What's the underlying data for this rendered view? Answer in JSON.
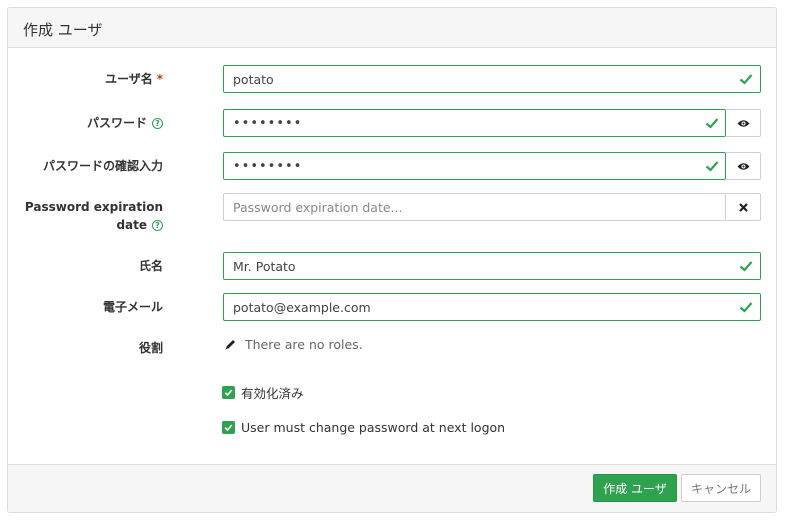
{
  "header": {
    "title": "作成 ユーザ"
  },
  "fields": {
    "username": {
      "label": "ユーザ名",
      "required_mark": "*",
      "value": "potato"
    },
    "password": {
      "label": "パスワード",
      "value": "••••••••"
    },
    "password_confirm": {
      "label": "パスワードの確認入力",
      "value": "••••••••"
    },
    "expiration": {
      "label_line1": "Password expiration",
      "label_line2": "date",
      "placeholder": "Password expiration date..."
    },
    "fullname": {
      "label": "氏名",
      "value": "Mr. Potato"
    },
    "email": {
      "label": "電子メール",
      "value": "potato@example.com"
    },
    "roles": {
      "label": "役割",
      "empty_text": "There are no roles."
    }
  },
  "options": {
    "enabled": {
      "label": "有効化済み",
      "checked": true
    },
    "must_change": {
      "label": "User must change password at next logon",
      "checked": true
    }
  },
  "footer": {
    "create_label": "作成 ユーザ",
    "cancel_label": "キャンセル"
  },
  "colors": {
    "success": "#2fa24f",
    "required": "#c0392b"
  },
  "icons": {
    "valid": "check-icon",
    "reveal": "eye-icon",
    "clear": "close-icon",
    "help": "help-icon",
    "edit": "pencil-icon"
  }
}
